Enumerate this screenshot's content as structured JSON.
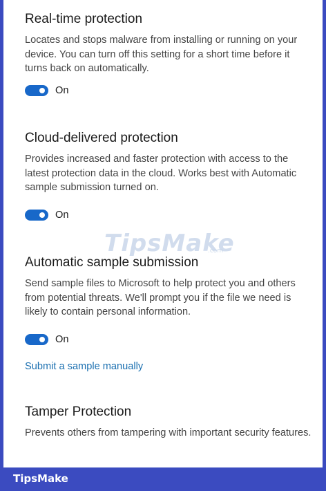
{
  "sections": [
    {
      "title": "Real-time protection",
      "description": "Locates and stops malware from installing or running on your device. You can turn off this setting for a short time before it turns back on automatically.",
      "toggle_label": "On"
    },
    {
      "title": "Cloud-delivered protection",
      "description": "Provides increased and faster protection with access to the latest protection data in the cloud. Works best with Automatic sample submission turned on.",
      "toggle_label": "On"
    },
    {
      "title": "Automatic sample submission",
      "description": "Send sample files to Microsoft to help protect you and others from potential threats. We'll prompt you if the file we need is likely to contain personal information.",
      "toggle_label": "On",
      "link_label": "Submit a sample manually"
    },
    {
      "title": "Tamper Protection",
      "description": "Prevents others from tampering with important security features."
    }
  ],
  "watermark": {
    "text": "TipsMake",
    "suffix": ".com"
  },
  "footer": {
    "brand": "TipsMake"
  },
  "colors": {
    "frame": "#3b4bc0",
    "toggle_on": "#1868c9",
    "link": "#1a6fb0"
  }
}
